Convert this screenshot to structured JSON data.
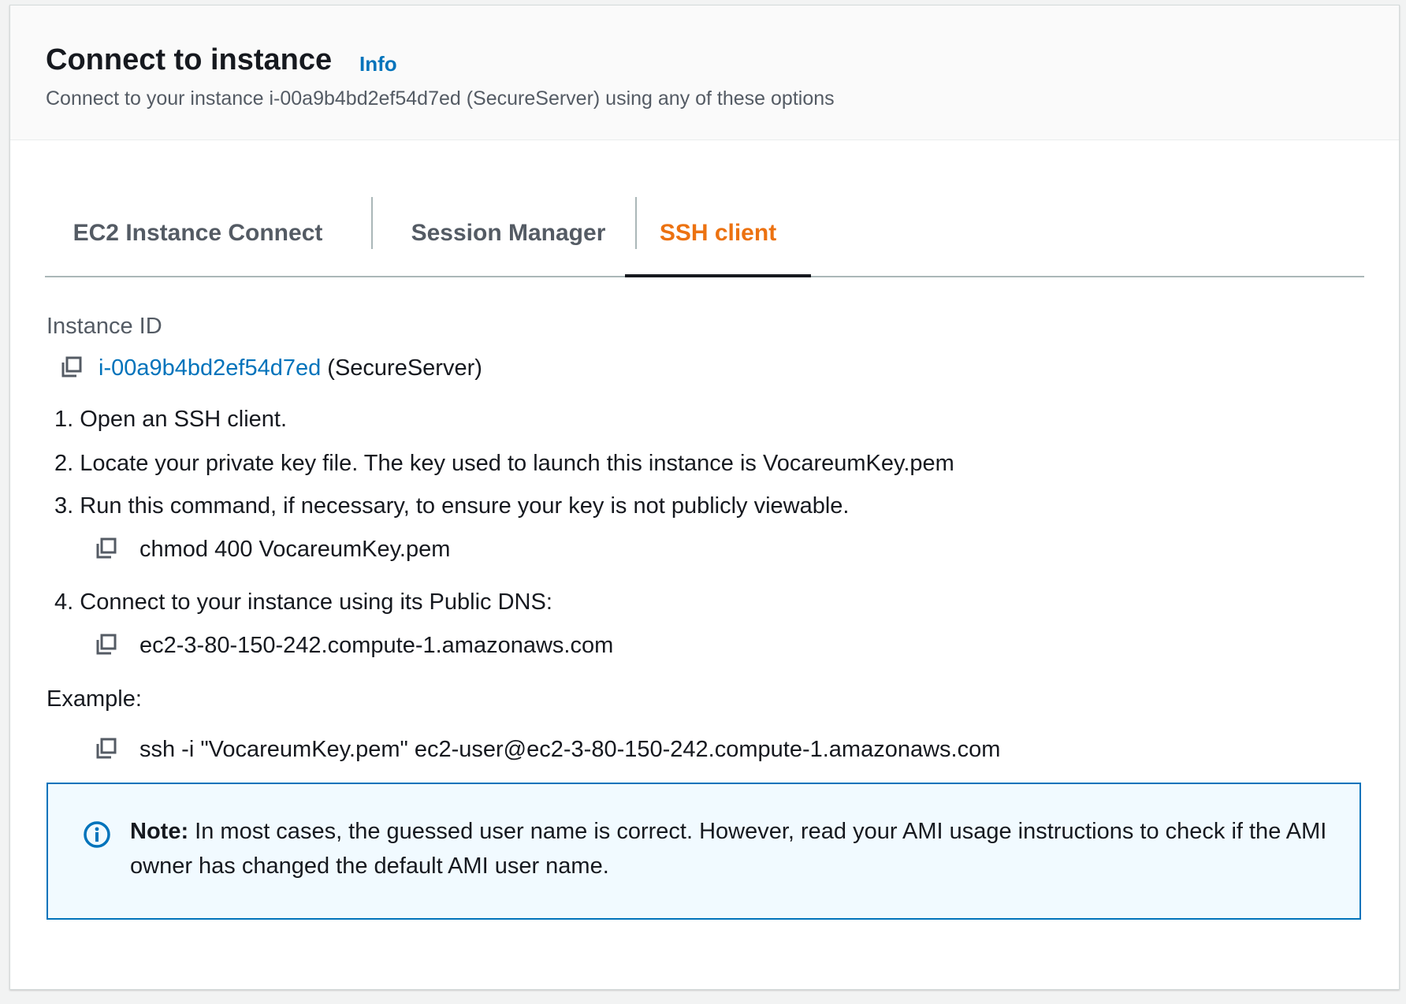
{
  "header": {
    "title": "Connect to instance",
    "info_link": "Info",
    "subtitle": "Connect to your instance i-00a9b4bd2ef54d7ed (SecureServer) using any of these options"
  },
  "tabs": [
    {
      "label": "EC2 Instance Connect",
      "active": false
    },
    {
      "label": "Session Manager",
      "active": false
    },
    {
      "label": "SSH client",
      "active": true
    }
  ],
  "instance": {
    "label": "Instance ID",
    "id": "i-00a9b4bd2ef54d7ed",
    "name": "(SecureServer)"
  },
  "steps": [
    {
      "number": "1.",
      "text": "Open an SSH client."
    },
    {
      "number": "2.",
      "text": "Locate your private key file. The key used to launch this instance is VocareumKey.pem"
    },
    {
      "number": "3.",
      "text": "Run this command, if necessary, to ensure your key is not publicly viewable."
    },
    {
      "number": "4.",
      "text": "Connect to your instance using its Public DNS:"
    }
  ],
  "commands": {
    "chmod": "chmod 400 VocareumKey.pem",
    "public_dns": "ec2-3-80-150-242.compute-1.amazonaws.com",
    "example_label": "Example:",
    "example": "ssh -i \"VocareumKey.pem\" ec2-user@ec2-3-80-150-242.compute-1.amazonaws.com"
  },
  "note": {
    "bold": "Note:",
    "text": " In most cases, the guessed user name is correct. However, read your AMI usage instructions to check if the AMI owner has changed the default AMI user name."
  },
  "colors": {
    "accent_orange": "#ec7211",
    "link_blue": "#0073bb",
    "note_bg": "#f1faff"
  },
  "icons": {
    "copy": "copy-icon",
    "info": "info-circle-icon"
  }
}
